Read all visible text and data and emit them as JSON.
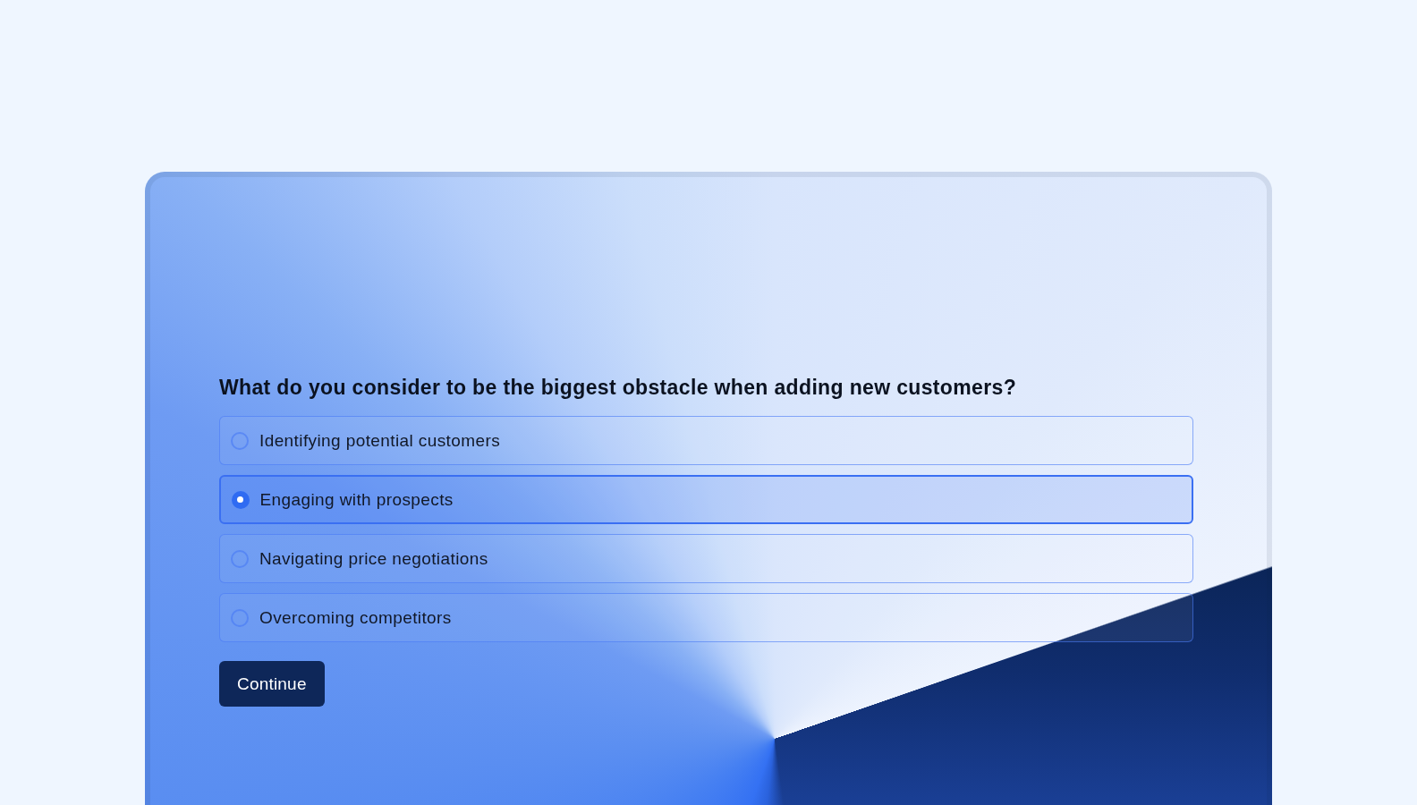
{
  "survey": {
    "question": "What do you consider to be the biggest obstacle when adding new customers?",
    "options": [
      {
        "label": "Identifying potential customers",
        "selected": false
      },
      {
        "label": "Engaging with prospects",
        "selected": true
      },
      {
        "label": "Navigating price negotiations",
        "selected": false
      },
      {
        "label": "Overcoming competitors",
        "selected": false
      }
    ],
    "button": {
      "label": "Continue"
    }
  }
}
